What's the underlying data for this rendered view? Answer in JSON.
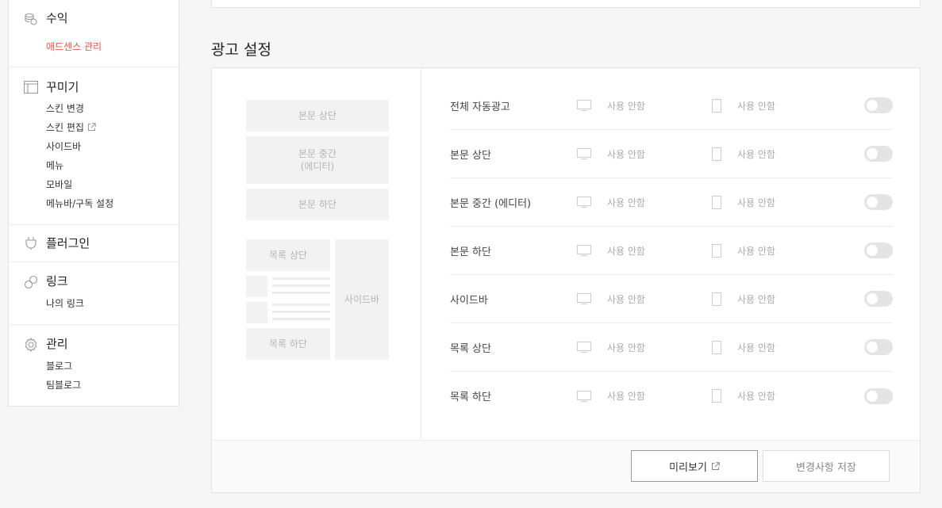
{
  "sidebar": {
    "revenue": {
      "title": "수익",
      "items": [
        "애드센스 관리"
      ]
    },
    "decorate": {
      "title": "꾸미기",
      "items": [
        "스킨 변경",
        "스킨 편집",
        "사이드바",
        "메뉴",
        "모바일",
        "메뉴바/구독 설정"
      ]
    },
    "plugin": {
      "title": "플러그인"
    },
    "link": {
      "title": "링크",
      "items": [
        "나의 링크"
      ]
    },
    "manage": {
      "title": "관리",
      "items": [
        "블로그",
        "팀블로그"
      ]
    }
  },
  "ad_settings": {
    "title": "광고 설정",
    "layout": {
      "body_top": "본문 상단",
      "body_middle_1": "본문 중간",
      "body_middle_2": "(에디터)",
      "body_bottom": "본문 하단",
      "list_top": "목록 상단",
      "list_bottom": "목록 하단",
      "sidebar": "사이드바"
    },
    "rows": [
      {
        "label": "전체 자동광고",
        "pc": "사용 안함",
        "mobile": "사용 안함",
        "enabled": false
      },
      {
        "label": "본문 상단",
        "pc": "사용 안함",
        "mobile": "사용 안함",
        "enabled": false
      },
      {
        "label": "본문 중간 (에디터)",
        "pc": "사용 안함",
        "mobile": "사용 안함",
        "enabled": false
      },
      {
        "label": "본문 하단",
        "pc": "사용 안함",
        "mobile": "사용 안함",
        "enabled": false
      },
      {
        "label": "사이드바",
        "pc": "사용 안함",
        "mobile": "사용 안함",
        "enabled": false
      },
      {
        "label": "목록 상단",
        "pc": "사용 안함",
        "mobile": "사용 안함",
        "enabled": false
      },
      {
        "label": "목록 하단",
        "pc": "사용 안함",
        "mobile": "사용 안함",
        "enabled": false
      }
    ],
    "preview_button": "미리보기",
    "save_button": "변경사항 저장"
  },
  "colors": {
    "accent": "#f5533d",
    "toggle_off": "#e4e4e4"
  }
}
